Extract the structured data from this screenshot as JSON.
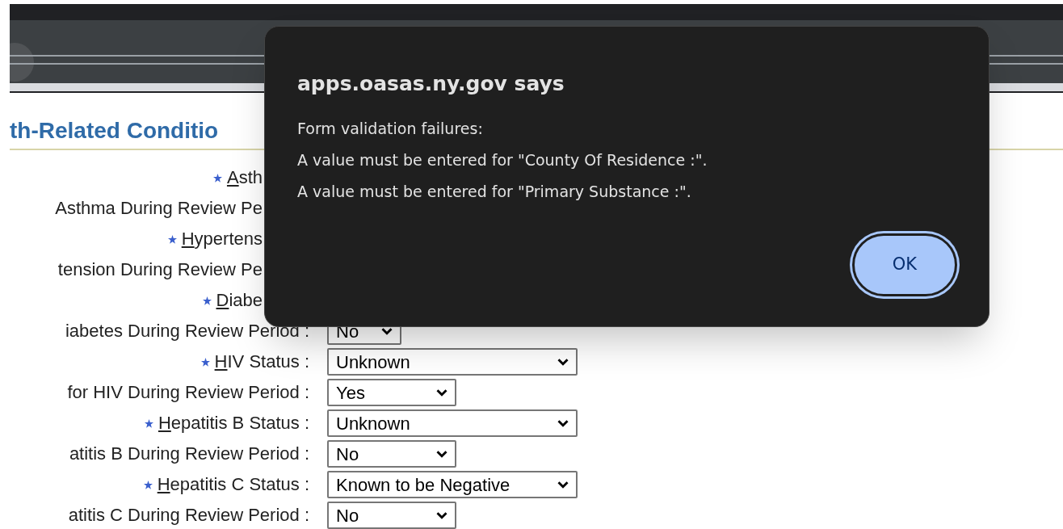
{
  "section_title": "th-Related Conditio",
  "rows": [
    {
      "label": "Asth",
      "required": true
    },
    {
      "label": "Asthma During Review Pe",
      "required": false
    },
    {
      "label": "Hypertens",
      "required": true
    },
    {
      "label": "tension During Review Pe",
      "required": false
    },
    {
      "label": "Diabe",
      "required": true
    },
    {
      "label": "iabetes During Review Period :",
      "required": false,
      "select": {
        "kind": "compact",
        "value": "No"
      }
    },
    {
      "label": "HIV Status :",
      "required": true,
      "select": {
        "kind": "status",
        "value": "Unknown"
      }
    },
    {
      "label": "for HIV During Review Period :",
      "required": false,
      "select": {
        "kind": "yes_no",
        "value": "Yes"
      }
    },
    {
      "label": "Hepatitis B Status :",
      "required": true,
      "select": {
        "kind": "status",
        "value": "Unknown"
      }
    },
    {
      "label": "atitis B During Review Period :",
      "required": false,
      "select": {
        "kind": "yes_no",
        "value": "No"
      }
    },
    {
      "label": "Hepatitis C Status :",
      "required": true,
      "select": {
        "kind": "status",
        "value": "Known to be Negative"
      }
    },
    {
      "label": "atitis C During Review Period :",
      "required": false,
      "select": {
        "kind": "yes_no",
        "value": "No"
      }
    }
  ],
  "dialog": {
    "title": "apps.oasas.ny.gov says",
    "lines": [
      "Form validation failures:",
      "A value must be entered for \"County Of Residence :\".",
      "A value must be entered for \"Primary Substance :\"."
    ],
    "button": "OK"
  }
}
